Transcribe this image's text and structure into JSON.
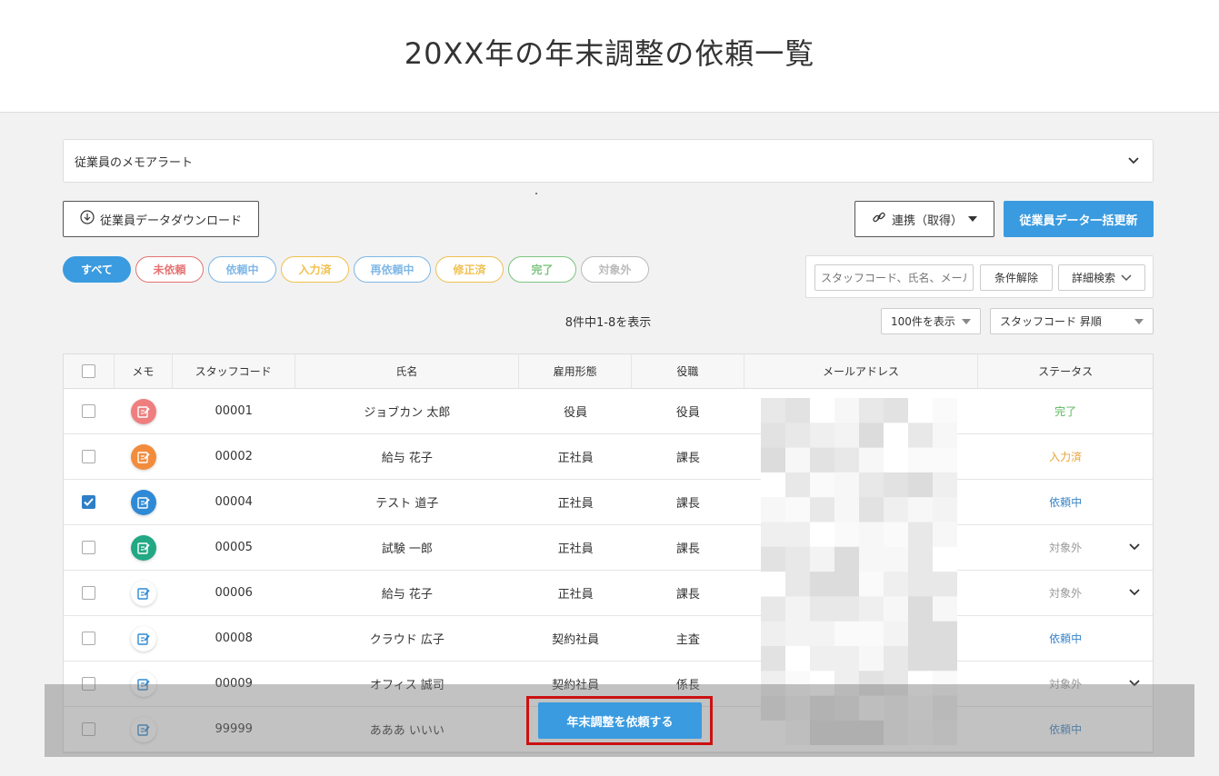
{
  "page": {
    "title": "20XX年の年末調整の依頼一覧"
  },
  "memo_alert": {
    "label": "従業員のメモアラート"
  },
  "toolbar": {
    "download_label": "従業員データダウンロード",
    "link_label": "連携（取得）",
    "bulk_update_label": "従業員データ一括更新"
  },
  "filters": [
    {
      "label": "すべて",
      "color": "#3a9be0",
      "active": true
    },
    {
      "label": "未依頼",
      "color": "#e57373",
      "active": false
    },
    {
      "label": "依頼中",
      "color": "#7fb7e6",
      "active": false
    },
    {
      "label": "入力済",
      "color": "#f0c050",
      "active": false
    },
    {
      "label": "再依頼中",
      "color": "#7fb7e6",
      "active": false
    },
    {
      "label": "修正済",
      "color": "#f0c050",
      "active": false
    },
    {
      "label": "完了",
      "color": "#7cc47f",
      "active": false
    },
    {
      "label": "対象外",
      "color": "#bbbbbb",
      "active": false
    }
  ],
  "search": {
    "placeholder": "スタッフコード、氏名、メールアドレス",
    "clear_label": "条件解除",
    "advanced_label": "詳細検索"
  },
  "result_count": "8件中1-8を表示",
  "per_page": "100件を表示",
  "sort": "スタッフコード 昇順",
  "table": {
    "headers": [
      "メモ",
      "スタッフコード",
      "氏名",
      "雇用形態",
      "役職",
      "メールアドレス",
      "ステータス"
    ],
    "rows": [
      {
        "checked": false,
        "memo_color": "#ef7f7f",
        "code": "00001",
        "name": "ジョブカン 太郎",
        "employment": "役員",
        "role": "役員",
        "status": "完了",
        "status_color": "#5cb85c",
        "expand": false
      },
      {
        "checked": false,
        "memo_color": "#f28c3c",
        "code": "00002",
        "name": "給与 花子",
        "employment": "正社員",
        "role": "課長",
        "status": "入力済",
        "status_color": "#e8a33a",
        "expand": false
      },
      {
        "checked": true,
        "memo_color": "#2f8ad6",
        "code": "00004",
        "name": "テスト 道子",
        "employment": "正社員",
        "role": "課長",
        "status": "依頼中",
        "status_color": "#3a86c8",
        "expand": false
      },
      {
        "checked": false,
        "memo_color": "#22a884",
        "code": "00005",
        "name": "試験 一郎",
        "employment": "正社員",
        "role": "課長",
        "status": "対象外",
        "status_color": "#999999",
        "expand": true
      },
      {
        "checked": false,
        "memo_color": "#ffffff",
        "code": "00006",
        "name": "給与 花子",
        "employment": "正社員",
        "role": "課長",
        "status": "対象外",
        "status_color": "#999999",
        "expand": true
      },
      {
        "checked": false,
        "memo_color": "#ffffff",
        "code": "00008",
        "name": "クラウド 広子",
        "employment": "契約社員",
        "role": "主査",
        "status": "依頼中",
        "status_color": "#3a86c8",
        "expand": false
      },
      {
        "checked": false,
        "memo_color": "#ffffff",
        "code": "00009",
        "name": "オフィス 誠司",
        "employment": "契約社員",
        "role": "係長",
        "status": "対象外",
        "status_color": "#999999",
        "expand": true
      },
      {
        "checked": false,
        "memo_color": "#ffffff",
        "code": "99999",
        "name": "あああ いいい",
        "employment": "",
        "role": "",
        "status": "依頼中",
        "status_color": "#3a86c8",
        "expand": false
      }
    ]
  },
  "request_button": {
    "label": "年末調整を依頼する"
  }
}
